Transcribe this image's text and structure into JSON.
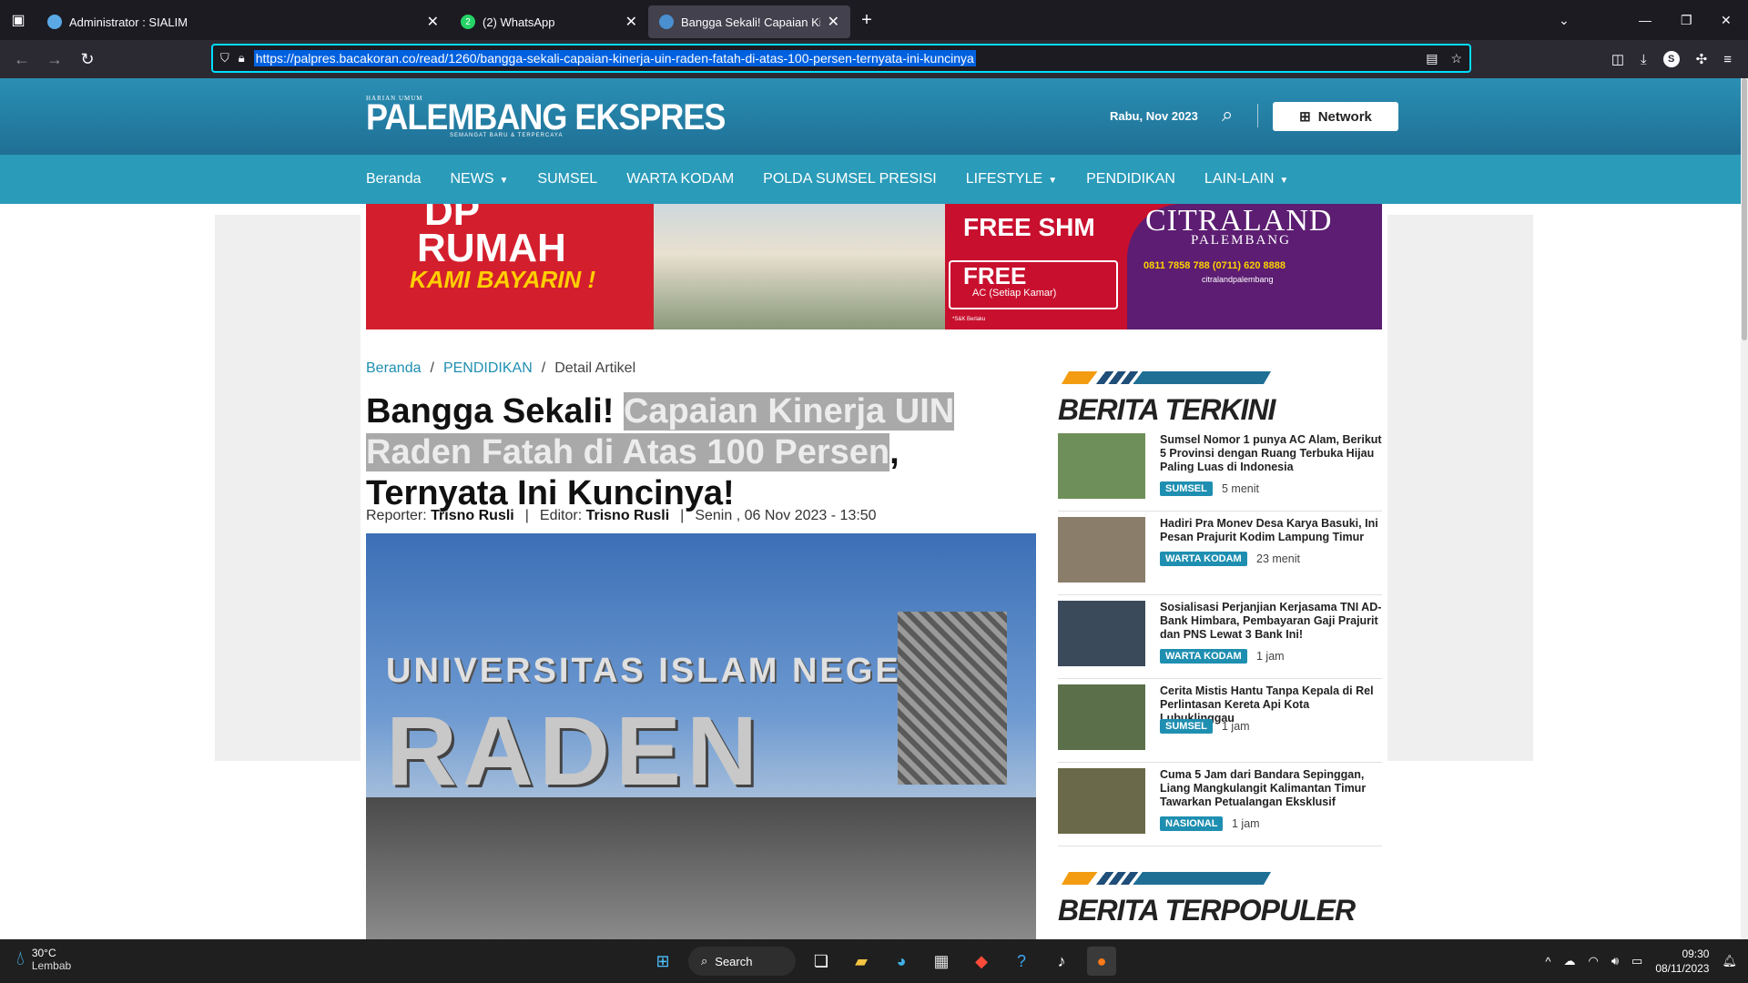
{
  "browser": {
    "tabs": [
      {
        "title": "Administrator : SIALIM",
        "fav_color": "#5aa9e6"
      },
      {
        "title": "(2) WhatsApp",
        "fav_color": "#25d366",
        "fav_text": "2"
      },
      {
        "title": "Bangga Sekali! Capaian Kinerja",
        "fav_color": "#4a8fd0"
      }
    ],
    "url": "https://palpres.bacakoran.co/read/1260/bangga-sekali-capaian-kinerja-uin-raden-fatah-di-atas-100-persen-ternyata-ini-kuncinya",
    "profile_initial": "S"
  },
  "site": {
    "logo_small": "HARIAN UMUM",
    "logo_name": "PALEMBANG EKSPRES",
    "logo_tagline": "SEMANGAT BARU & TERPERCAYA",
    "date": "Rabu, Nov 2023",
    "network_label": "Network",
    "nav": [
      {
        "label": "Beranda",
        "dropdown": false
      },
      {
        "label": "NEWS",
        "dropdown": true
      },
      {
        "label": "SUMSEL",
        "dropdown": false
      },
      {
        "label": "WARTA KODAM",
        "dropdown": false
      },
      {
        "label": "POLDA SUMSEL PRESISI",
        "dropdown": false
      },
      {
        "label": "LIFESTYLE",
        "dropdown": true
      },
      {
        "label": "PENDIDIKAN",
        "dropdown": false
      },
      {
        "label": "LAIN-LAIN",
        "dropdown": true
      }
    ]
  },
  "banner": {
    "dp": "DP",
    "rumah": "RUMAH",
    "kami": "KAMI BAYARIN !",
    "free_shm": "FREE SHM",
    "free": "FREE",
    "ac": "AC (Setiap Kamar)",
    "snk": "*S&K Berlaku",
    "brand": "CITRALAND",
    "city": "PALEMBANG",
    "phones": "0811 7858 788  (0711) 620 8888",
    "social": "citralandpalembang"
  },
  "article": {
    "breadcrumb": [
      "Beranda",
      "PENDIDIKAN",
      "Detail Artikel"
    ],
    "title_part1": "Bangga Sekali! ",
    "title_highlight": "Capaian Kinerja UIN Raden Fatah di Atas 100 Persen",
    "title_part2": ", Ternyata Ini Kuncinya!",
    "reporter_label": "Reporter:",
    "reporter": "Trisno Rusli",
    "editor_label": "Editor:",
    "editor": "Trisno Rusli",
    "datetime": "Senin , 06 Nov 2023 - 13:50",
    "image_sign_top": "UNIVERSITAS ISLAM NEGERI",
    "image_sign_main": "RADEN FATAH"
  },
  "sidebar": {
    "latest_title": "BERITA TERKINI",
    "popular_title": "BERITA TERPOPULER",
    "items": [
      {
        "headline": "Sumsel Nomor 1 punya AC Alam, Berikut 5 Provinsi dengan Ruang Terbuka Hijau Paling Luas di Indonesia",
        "category": "SUMSEL",
        "age": "5 menit",
        "thumb": "#6f8f5a"
      },
      {
        "headline": "Hadiri Pra Monev Desa Karya Basuki, Ini Pesan Prajurit Kodim Lampung Timur",
        "category": "WARTA KODAM",
        "age": "23 menit",
        "thumb": "#8a7d6a"
      },
      {
        "headline": "Sosialisasi Perjanjian Kerjasama TNI AD-Bank Himbara, Pembayaran Gaji Prajurit dan PNS Lewat 3 Bank Ini!",
        "category": "WARTA KODAM",
        "age": "1 jam",
        "thumb": "#3a4a5a"
      },
      {
        "headline": "Cerita Mistis Hantu Tanpa Kepala di Rel Perlintasan Kereta Api Kota Lubuklinggau",
        "category": "SUMSEL",
        "age": "1 jam",
        "thumb": "#5a6f4a"
      },
      {
        "headline": "Cuma 5 Jam dari Bandara Sepinggan, Liang Mangkulangit Kalimantan Timur Tawarkan Petualangan Eksklusif",
        "category": "NASIONAL",
        "age": "1 jam",
        "thumb": "#6a6a4a"
      }
    ]
  },
  "taskbar": {
    "temp": "30°C",
    "weather": "Lembab",
    "search": "Search",
    "time": "09:30",
    "date": "08/11/2023"
  }
}
